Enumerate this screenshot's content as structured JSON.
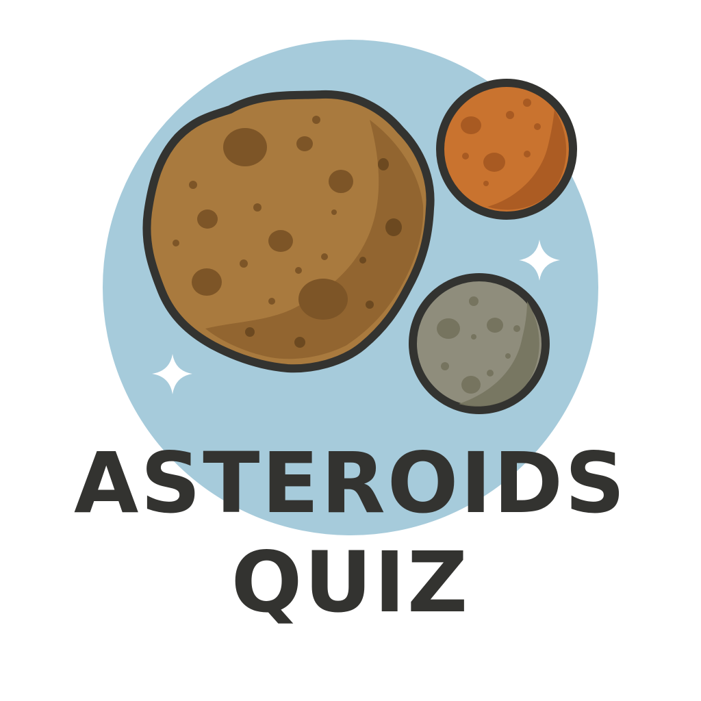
{
  "title": {
    "line1": "ASTEROIDS",
    "line2": "QUIZ"
  },
  "colors": {
    "background": "#ffffff",
    "circle": "#a6cbdb",
    "large_asteroid": "#a97a3e",
    "orange_asteroid": "#c9732f",
    "gray_asteroid": "#8f8d7c",
    "outline": "#333330",
    "sparkle": "#ffffff",
    "text": "#333330"
  },
  "icons": [
    "large-asteroid-icon",
    "orange-asteroid-icon",
    "gray-asteroid-icon",
    "sparkle-icon"
  ]
}
